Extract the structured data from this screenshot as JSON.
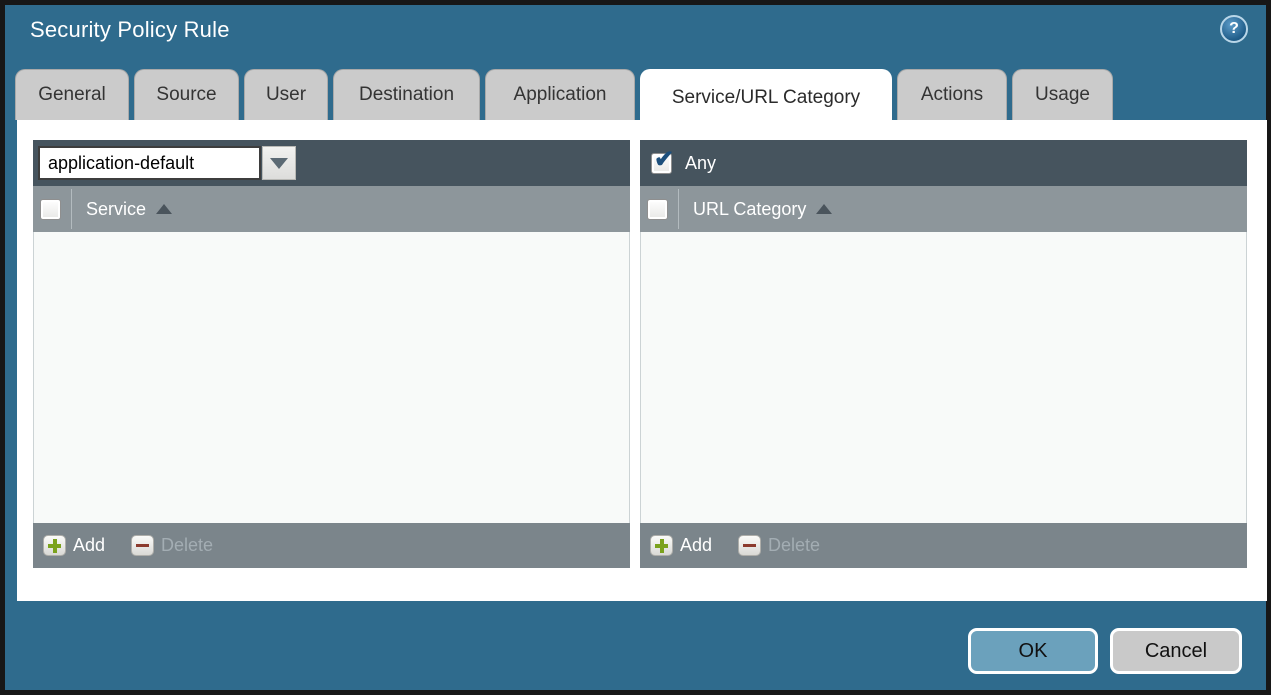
{
  "window": {
    "title": "Security Policy Rule",
    "help_icon_glyph": "?"
  },
  "tabs": [
    {
      "label": "General",
      "active": false
    },
    {
      "label": "Source",
      "active": false
    },
    {
      "label": "User",
      "active": false
    },
    {
      "label": "Destination",
      "active": false
    },
    {
      "label": "Application",
      "active": false
    },
    {
      "label": "Service/URL Category",
      "active": true
    },
    {
      "label": "Actions",
      "active": false
    },
    {
      "label": "Usage",
      "active": false
    }
  ],
  "service_panel": {
    "dropdown_value": "application-default",
    "column_header": "Service",
    "select_all_checked": false,
    "rows": [],
    "add_label": "Add",
    "delete_label": "Delete",
    "delete_enabled": false
  },
  "url_category_panel": {
    "any_label": "Any",
    "any_checked": true,
    "column_header": "URL Category",
    "select_all_checked": false,
    "rows": [],
    "add_label": "Add",
    "delete_label": "Delete",
    "delete_enabled": false
  },
  "footer": {
    "ok_label": "OK",
    "cancel_label": "Cancel"
  },
  "colors": {
    "dialog_background": "#2f6b8d",
    "panel_topbar": "#46545e",
    "panel_header": "#8d969b",
    "panel_footer": "#7b858b",
    "panel_body": "#f8faf9",
    "tab_inactive": "#cbcbcb",
    "tab_active": "#ffffff",
    "ok_button": "#6ba1bc",
    "cancel_button": "#c9c9c9",
    "add_icon_green": "#7ba21d",
    "delete_icon_red": "#8c3b2e",
    "checkmark_blue": "#1d4f7c"
  }
}
